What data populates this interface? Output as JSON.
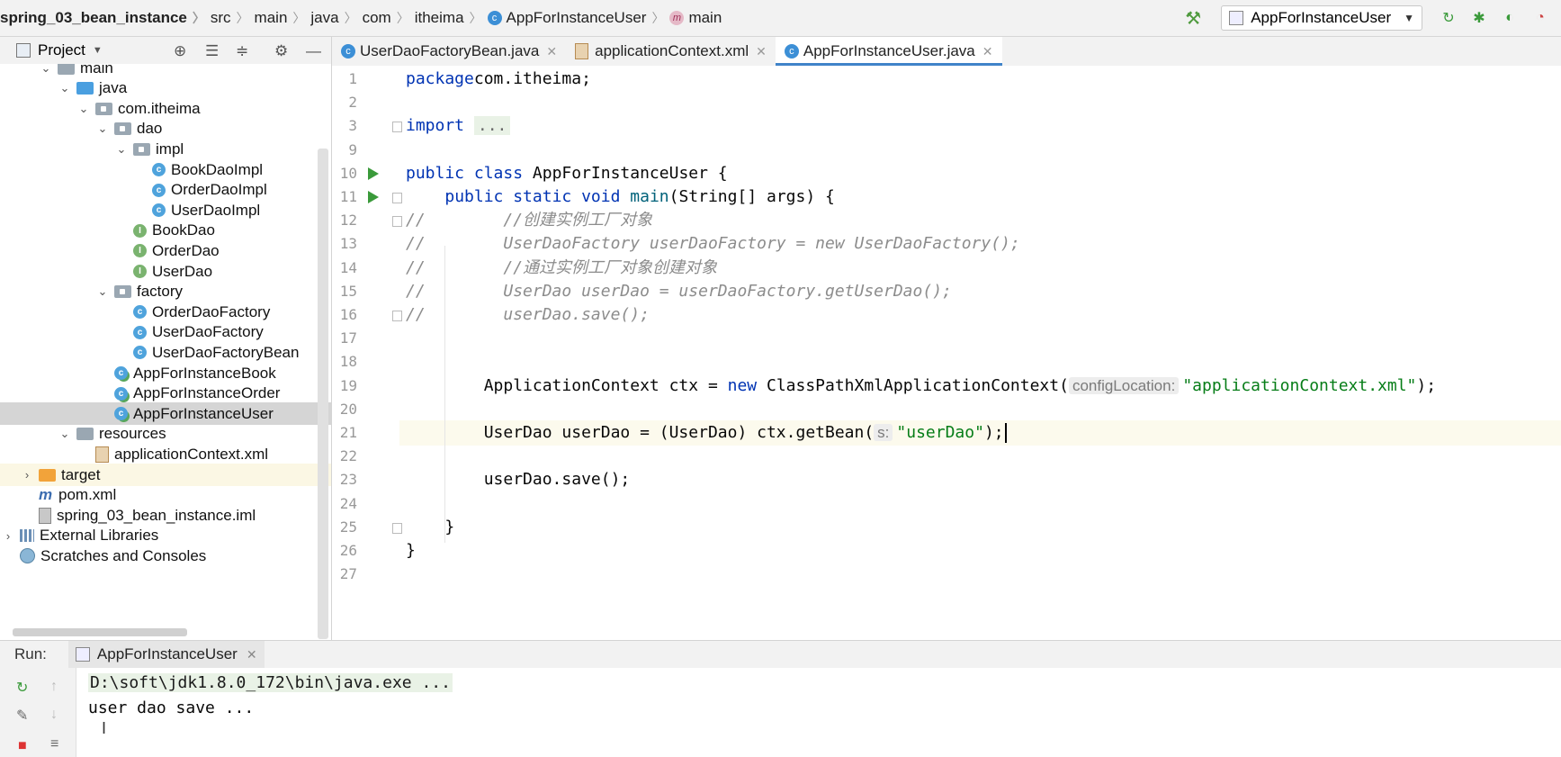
{
  "breadcrumb": {
    "project": "spring_03_bean_instance",
    "items": [
      "src",
      "main",
      "java",
      "com",
      "itheima"
    ],
    "class_name": "AppForInstanceUser",
    "method": "main"
  },
  "toolbar": {
    "run_config": "AppForInstanceUser"
  },
  "project_panel": {
    "title": "Project",
    "tree": [
      {
        "label": "main",
        "depth": 2,
        "kind": "folder",
        "arrow": "v"
      },
      {
        "label": "java",
        "depth": 3,
        "kind": "folder-blue",
        "arrow": "v"
      },
      {
        "label": "com.itheima",
        "depth": 4,
        "kind": "package",
        "arrow": "v"
      },
      {
        "label": "dao",
        "depth": 5,
        "kind": "package",
        "arrow": "v"
      },
      {
        "label": "impl",
        "depth": 6,
        "kind": "package",
        "arrow": "v"
      },
      {
        "label": "BookDaoImpl",
        "depth": 7,
        "kind": "class"
      },
      {
        "label": "OrderDaoImpl",
        "depth": 7,
        "kind": "class"
      },
      {
        "label": "UserDaoImpl",
        "depth": 7,
        "kind": "class"
      },
      {
        "label": "BookDao",
        "depth": 6,
        "kind": "interface"
      },
      {
        "label": "OrderDao",
        "depth": 6,
        "kind": "interface"
      },
      {
        "label": "UserDao",
        "depth": 6,
        "kind": "interface"
      },
      {
        "label": "factory",
        "depth": 5,
        "kind": "package",
        "arrow": "v"
      },
      {
        "label": "OrderDaoFactory",
        "depth": 6,
        "kind": "class"
      },
      {
        "label": "UserDaoFactory",
        "depth": 6,
        "kind": "class"
      },
      {
        "label": "UserDaoFactoryBean",
        "depth": 6,
        "kind": "class"
      },
      {
        "label": "AppForInstanceBook",
        "depth": 5,
        "kind": "class-run"
      },
      {
        "label": "AppForInstanceOrder",
        "depth": 5,
        "kind": "class-run"
      },
      {
        "label": "AppForInstanceUser",
        "depth": 5,
        "kind": "class-run",
        "selected": true
      },
      {
        "label": "resources",
        "depth": 3,
        "kind": "folder",
        "arrow": "v"
      },
      {
        "label": "applicationContext.xml",
        "depth": 4,
        "kind": "xml"
      },
      {
        "label": "target",
        "depth": 1,
        "kind": "folder-orange",
        "arrow": ">",
        "highlight": true
      },
      {
        "label": "pom.xml",
        "depth": 1,
        "kind": "maven"
      },
      {
        "label": "spring_03_bean_instance.iml",
        "depth": 1,
        "kind": "iml"
      },
      {
        "label": "External Libraries",
        "depth": 0,
        "kind": "library",
        "arrow": ">"
      },
      {
        "label": "Scratches and Consoles",
        "depth": 0,
        "kind": "scratches"
      }
    ]
  },
  "tabs": [
    {
      "label": "UserDaoFactoryBean.java",
      "kind": "class",
      "active": false
    },
    {
      "label": "applicationContext.xml",
      "kind": "xml",
      "active": false
    },
    {
      "label": "AppForInstanceUser.java",
      "kind": "class",
      "active": true
    }
  ],
  "editor": {
    "lines": [
      {
        "num": "1",
        "html_tokens": [
          [
            "kw",
            "package"
          ],
          [
            "",
            "com.itheima;"
          ]
        ]
      },
      {
        "num": "2",
        "html_tokens": []
      },
      {
        "num": "3",
        "html_tokens": [
          [
            "kw",
            "import "
          ],
          [
            "fold",
            "..."
          ]
        ]
      },
      {
        "num": "9",
        "html_tokens": []
      },
      {
        "num": "10",
        "html_tokens": [
          [
            "kw",
            "public class "
          ],
          [
            "",
            "AppForInstanceUser {"
          ]
        ]
      },
      {
        "num": "11",
        "html_tokens": [
          [
            "",
            "    "
          ],
          [
            "kw",
            "public static void "
          ],
          [
            "fn",
            "main"
          ],
          [
            "",
            "(String[] args) {"
          ]
        ]
      },
      {
        "num": "12",
        "html_tokens": [
          [
            "cmt",
            "//        //创建实例工厂对象"
          ]
        ]
      },
      {
        "num": "13",
        "html_tokens": [
          [
            "cmt",
            "//        UserDaoFactory userDaoFactory = new UserDaoFactory();"
          ]
        ]
      },
      {
        "num": "14",
        "html_tokens": [
          [
            "cmt",
            "//        //通过实例工厂对象创建对象"
          ]
        ]
      },
      {
        "num": "15",
        "html_tokens": [
          [
            "cmt",
            "//        UserDao userDao = userDaoFactory.getUserDao();"
          ]
        ]
      },
      {
        "num": "16",
        "html_tokens": [
          [
            "cmt",
            "//        userDao.save();"
          ]
        ]
      },
      {
        "num": "17",
        "html_tokens": []
      },
      {
        "num": "18",
        "html_tokens": []
      },
      {
        "num": "19",
        "html_tokens": [
          [
            "",
            "        ApplicationContext ctx = "
          ],
          [
            "kw",
            "new "
          ],
          [
            "",
            "ClassPathXmlApplicationContext("
          ],
          [
            "hint",
            "configLocation:"
          ],
          [
            "str",
            "\"applicationContext.xml\""
          ],
          [
            "",
            ");"
          ]
        ]
      },
      {
        "num": "20",
        "html_tokens": []
      },
      {
        "num": "21",
        "html_tokens": [
          [
            "",
            "        UserDao userDao = (UserDao) ctx.getBean("
          ],
          [
            "hint",
            "s:"
          ],
          [
            "str",
            "\"userDao\""
          ],
          [
            "",
            ");"
          ],
          [
            "caret",
            ""
          ]
        ]
      },
      {
        "num": "22",
        "html_tokens": []
      },
      {
        "num": "23",
        "html_tokens": [
          [
            "",
            "        userDao.save();"
          ]
        ]
      },
      {
        "num": "24",
        "html_tokens": []
      },
      {
        "num": "25",
        "html_tokens": [
          [
            "",
            "    }"
          ]
        ]
      },
      {
        "num": "26",
        "html_tokens": [
          [
            "",
            "}"
          ]
        ]
      },
      {
        "num": "27",
        "html_tokens": []
      }
    ]
  },
  "run_panel": {
    "label": "Run:",
    "tab_label": "AppForInstanceUser",
    "console": [
      "D:\\soft\\jdk1.8.0_172\\bin\\java.exe ...",
      "user dao save ..."
    ]
  }
}
